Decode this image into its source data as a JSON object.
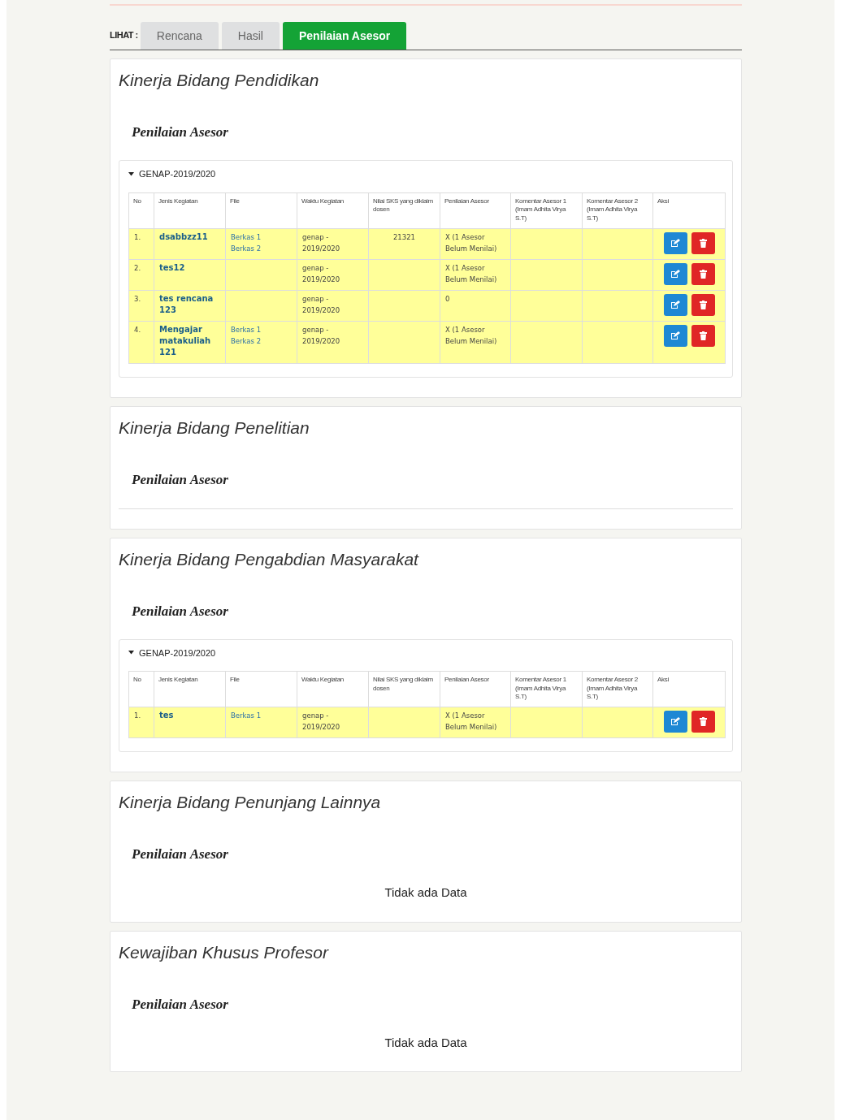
{
  "view_label": "LIHAT :",
  "tabs": [
    {
      "label": "Rencana",
      "selected": false
    },
    {
      "label": "Hasil",
      "selected": false
    },
    {
      "label": "Penilaian Asesor",
      "selected": true
    }
  ],
  "sections": [
    {
      "title": "Kinerja Bidang Pendidikan",
      "subtitle": "Penilaian Asesor",
      "kind": "table",
      "groups": [
        {
          "label": "GENAP-2019/2020",
          "expanded": true,
          "columns": [
            "No",
            "Jenis Kegiatan",
            "File",
            "Waktu Kegiatan",
            "Nilai SKS yang diklaim dosen",
            "Penilaian Asesor",
            "Komentar Asesor 1 (Imam Adhita Virya S.T)",
            "Komentar Asesor 2 (Imam Adhita Virya S.T)",
            "Aksi"
          ],
          "rows": [
            {
              "no": "1.",
              "activity": "dsabbzz11",
              "files": [
                "Berkas 1",
                "Berkas 2"
              ],
              "time": "genap - 2019/2020",
              "credits": "21321",
              "assessment": "X (1 Asesor Belum Menilai)"
            },
            {
              "no": "2.",
              "activity": "tes12",
              "files": [],
              "time": "genap - 2019/2020",
              "assessment": "X (1 Asesor Belum Menilai)"
            },
            {
              "no": "3.",
              "activity": "tes rencana 123",
              "files": [],
              "time": "genap - 2019/2020",
              "assessment": "0"
            },
            {
              "no": "4.",
              "activity": "Mengajar matakuliah 121",
              "files": [
                "Berkas 1",
                "Berkas 2"
              ],
              "time": "genap - 2019/2020",
              "assessment": "X (1 Asesor Belum Menilai)"
            }
          ]
        }
      ]
    },
    {
      "title": "Kinerja Bidang Penelitian",
      "subtitle": "Penilaian Asesor",
      "kind": "empty"
    },
    {
      "title": "Kinerja Bidang Pengabdian Masyarakat",
      "subtitle": "Penilaian Asesor",
      "kind": "table",
      "groups": [
        {
          "label": "GENAP-2019/2020",
          "expanded": true,
          "columns": [
            "No",
            "Jenis Kegiatan",
            "File",
            "Waktu Kegiatan",
            "Nilai SKS yang diklaim dosen",
            "Penilaian Asesor",
            "Komentar Asesor 1 (Imam Adhita Virya S.T)",
            "Komentar Asesor 2 (Imam Adhita Virya S.T)",
            "Aksi"
          ],
          "rows": [
            {
              "no": "1.",
              "activity": "tes",
              "files": [
                "Berkas 1"
              ],
              "time": "genap - 2019/2020",
              "assessment": "X (1 Asesor Belum Menilai)"
            }
          ]
        }
      ]
    },
    {
      "title": "Kinerja Bidang Penunjang Lainnya",
      "subtitle": "Penilaian Asesor",
      "kind": "message",
      "message": "Tidak ada Data"
    },
    {
      "title": "Kewajiban Khusus Profesor",
      "subtitle": "Penilaian Asesor",
      "kind": "message",
      "message": "Tidak ada Data"
    }
  ]
}
